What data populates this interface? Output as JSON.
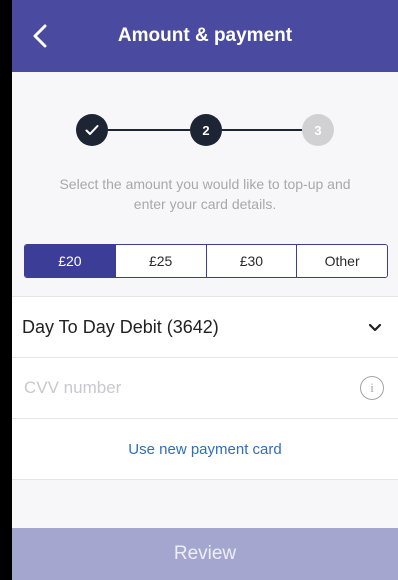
{
  "header": {
    "title": "Amount & payment"
  },
  "stepper": {
    "step2": "2",
    "step3": "3"
  },
  "instructions": "Select the amount you would like to top-up and enter your card details.",
  "amounts": [
    {
      "label": "£20",
      "selected": true
    },
    {
      "label": "£25",
      "selected": false
    },
    {
      "label": "£30",
      "selected": false
    },
    {
      "label": "Other",
      "selected": false
    }
  ],
  "payment": {
    "card_label": "Day To Day Debit (3642)",
    "cvv_placeholder": "CVV number",
    "new_card_link": "Use new payment card"
  },
  "footer": {
    "review_label": "Review"
  },
  "colors": {
    "header": "#4a4ba0",
    "accent": "#3c3d97",
    "step_done": "#1d2535",
    "step_pending": "#d1d1d4",
    "link": "#2f6fb8",
    "review_disabled": "#a5a6cf"
  }
}
